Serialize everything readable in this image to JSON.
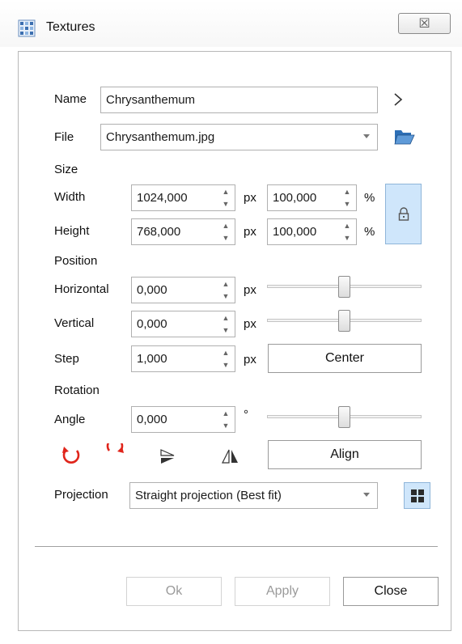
{
  "window": {
    "title": "Textures",
    "close_glyph": "☒"
  },
  "name": {
    "label": "Name",
    "value": "Chrysanthemum"
  },
  "file": {
    "label": "File",
    "value": "Chrysanthemum.jpg"
  },
  "size": {
    "section_label": "Size",
    "width": {
      "label": "Width",
      "px_value": "1024,000",
      "px_unit": "px",
      "pct_value": "100,000",
      "pct_unit": "%"
    },
    "height": {
      "label": "Height",
      "px_value": "768,000",
      "px_unit": "px",
      "pct_value": "100,000",
      "pct_unit": "%"
    }
  },
  "position": {
    "section_label": "Position",
    "horizontal": {
      "label": "Horizontal",
      "value": "0,000",
      "unit": "px",
      "slider_fraction": 0.5
    },
    "vertical": {
      "label": "Vertical",
      "value": "0,000",
      "unit": "px",
      "slider_fraction": 0.5
    },
    "step": {
      "label": "Step",
      "value": "1,000",
      "unit": "px"
    },
    "center_label": "Center"
  },
  "rotation": {
    "section_label": "Rotation",
    "angle": {
      "label": "Angle",
      "value": "0,000",
      "unit": "°",
      "slider_fraction": 0.5
    },
    "align_label": "Align"
  },
  "projection": {
    "label": "Projection",
    "value": "Straight projection (Best fit)"
  },
  "footer": {
    "ok_label": "Ok",
    "apply_label": "Apply",
    "close_label": "Close"
  },
  "icons": {
    "app": "texture-grid-icon",
    "next": "chevron-right-icon",
    "open_folder": "folder-open-icon",
    "lock": "lock-icon",
    "rotate_cw": "rotate-clockwise-icon",
    "rotate_ccw": "rotate-counterclockwise-icon",
    "flip_vertical": "flip-vertical-icon",
    "flip_horizontal": "flip-horizontal-icon",
    "projection_layout": "layout-grid-icon"
  },
  "colors": {
    "accent_blue": "#cfe6fb",
    "rotate_red": "#e0251b",
    "folder_blue": "#2d6fb6"
  }
}
